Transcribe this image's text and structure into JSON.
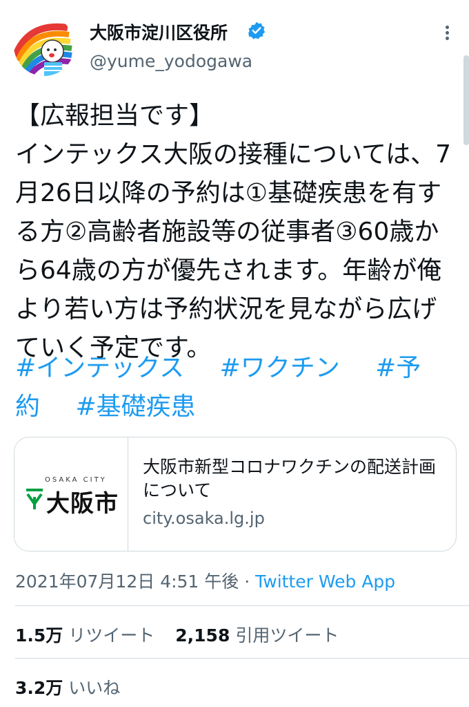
{
  "account": {
    "display_name": "大阪市淀川区役所",
    "handle": "@yume_yodogawa",
    "avatar_icon": "rainbow-mascot-avatar",
    "verified_icon": "verified-badge-icon",
    "more_icon": "more-vertical-icon"
  },
  "tweet": {
    "lines": [
      "【広報担当です】",
      "インテックス大阪の接種については、7月26日以降の予約は①基礎疾患を有する方②高齢者施設等の従事者③60歳から64歳の方が優先されます。年齢が俺より若い方は予約状況を見ながら広げていく予定です。"
    ],
    "hashtags": [
      "#インテックス",
      "#ワクチン",
      "#予約",
      "#基礎疾患"
    ]
  },
  "card": {
    "logo_small_text": "OSAKA CITY",
    "logo_name": "大阪市",
    "title": "大阪市新型コロナワクチンの配送計画について",
    "domain": "city.osaka.lg.jp"
  },
  "meta": {
    "timestamp": "2021年07月12日 4:51 午後",
    "separator": "·",
    "source": "Twitter Web App"
  },
  "stats": {
    "retweets": {
      "count": "1.5万",
      "label": "リツイート"
    },
    "quotes": {
      "count": "2,158",
      "label": "引用ツイート"
    },
    "likes": {
      "count": "3.2万",
      "label": "いいね"
    }
  },
  "colors": {
    "link": "#1d9bf0",
    "secondary_text": "#536471",
    "divider": "#cfd9de",
    "osaka_green": "#00a040"
  }
}
